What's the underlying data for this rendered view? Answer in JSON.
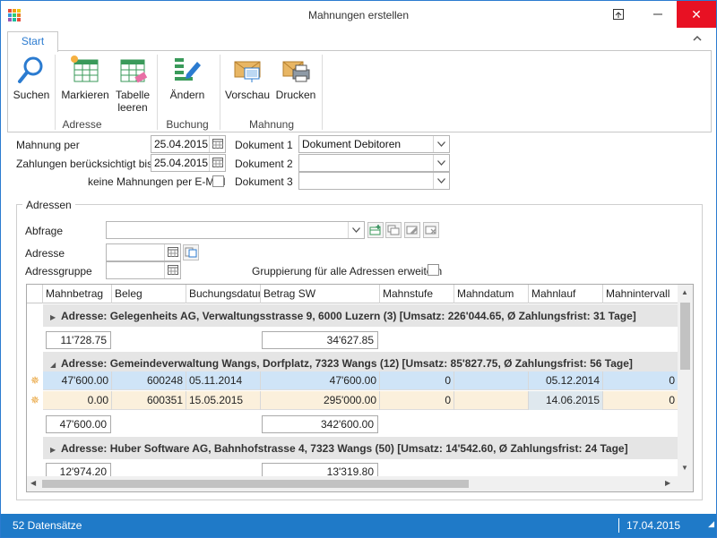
{
  "window": {
    "title": "Mahnungen erstellen",
    "restore_icon": "restore-icon",
    "close_label": "✕"
  },
  "ribbon": {
    "tab": "Start",
    "collapse_icon": "chevron-up-icon",
    "buttons": {
      "suchen": "Suchen",
      "markieren": "Markieren",
      "tabelle_l1": "Tabelle",
      "tabelle_l2": "leeren",
      "aendern": "Ändern",
      "vorschau": "Vorschau",
      "drucken": "Drucken"
    },
    "groups": {
      "adresse": "Adresse",
      "buchung": "Buchung",
      "mahnung": "Mahnung"
    }
  },
  "form": {
    "mahnung_per_label": "Mahnung per",
    "mahnung_per_value": "25.04.2015",
    "zahlungen_label": "Zahlungen berücksichtigt bis",
    "zahlungen_value": "25.04.2015",
    "email_label": "keine Mahnungen per E-Mail",
    "dok1_label": "Dokument 1",
    "dok1_value": "Dokument Debitoren",
    "dok2_label": "Dokument 2",
    "dok2_value": "",
    "dok3_label": "Dokument 3",
    "dok3_value": ""
  },
  "adressen": {
    "title": "Adressen",
    "abfrage_label": "Abfrage",
    "adresse_label": "Adresse",
    "adressgruppe_label": "Adressgruppe",
    "gruppierung_label": "Gruppierung für alle Adressen erweitern"
  },
  "grid": {
    "columns": [
      "Mahnbetrag",
      "Beleg",
      "Buchungsdatum",
      "Betrag SW",
      "Mahnstufe",
      "Mahndatum",
      "Mahnlauf",
      "Mahnintervall"
    ],
    "groups": [
      {
        "header": "Adresse: Gelegenheits AG, Verwaltungsstrasse 9, 6000 Luzern (3) [Umsatz: 226'044.65, Ø Zahlungsfrist: 31 Tage]",
        "sum_mahnbetrag": "11'728.75",
        "sum_betrag": "34'627.85"
      },
      {
        "header": "Adresse: Gemeindeverwaltung Wangs, Dorfplatz, 7323 Wangs (12) [Umsatz: 85'827.75, Ø Zahlungsfrist: 56 Tage]",
        "rows": [
          {
            "mahnbetrag": "47'600.00",
            "beleg": "600248",
            "buchungsdatum": "05.11.2014",
            "betrag": "47'600.00",
            "mahnstufe": "0",
            "mahndatum": "",
            "mahnlauf": "05.12.2014",
            "intervall": "0"
          },
          {
            "mahnbetrag": "0.00",
            "beleg": "600351",
            "buchungsdatum": "15.05.2015",
            "betrag": "295'000.00",
            "mahnstufe": "0",
            "mahndatum": "",
            "mahnlauf": "14.06.2015",
            "intervall": "0"
          }
        ],
        "sum_mahnbetrag": "47'600.00",
        "sum_betrag": "342'600.00"
      },
      {
        "header": "Adresse: Huber Software AG, Bahnhofstrasse 4, 7323 Wangs (50) [Umsatz: 14'542.60, Ø Zahlungsfrist: 24 Tage]",
        "sum_mahnbetrag": "12'974.20",
        "sum_betrag": "13'319.80"
      }
    ]
  },
  "status": {
    "count": "52 Datensätze",
    "date": "17.04.2015"
  },
  "colors": {
    "accent": "#2b7bd0",
    "status_bar": "#1f7ac8",
    "selected_row": "#cfe4f7",
    "alt_row": "#fbf0dc",
    "close_red": "#e81123"
  }
}
